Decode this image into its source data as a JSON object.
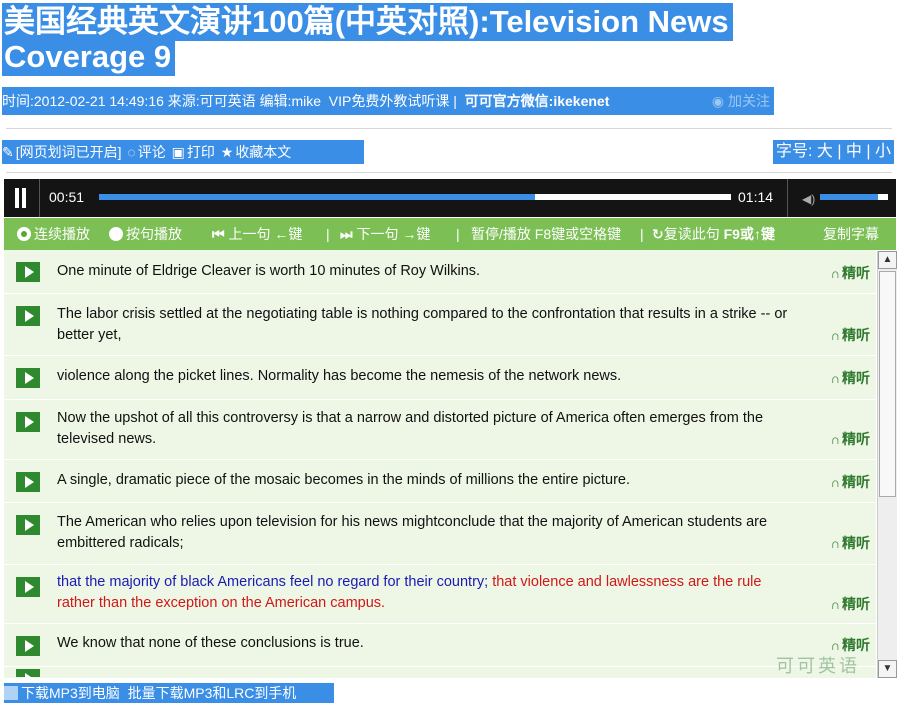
{
  "title": {
    "line1": "美国经典英文演讲100篇(中英对照):Television News",
    "line2": "Coverage 9"
  },
  "meta": {
    "time": "时间:2012-02-21 14:49:16",
    "source": "来源:可可英语",
    "editor": "编辑:mike",
    "vip": "VIP免费外教试听课 |",
    "wechat": "可可官方微信:ikekenet",
    "follow": "加关注"
  },
  "toolbar": {
    "word_lookup": "[网页划词已开启]",
    "comment": "评论",
    "print": "打印",
    "bookmark": "收藏本文"
  },
  "font_size": {
    "label": "字号:",
    "large": "大",
    "medium": "中",
    "small": "小"
  },
  "player": {
    "current": "00:51",
    "duration": "01:14",
    "progress": 0.69,
    "volume": 0.85
  },
  "controls": {
    "continuous": "连续播放",
    "by_sentence": "按句播放",
    "prev": "上一句",
    "prev_key": "←键",
    "next": "下一句",
    "next_key": "→键",
    "pause": "暂停/播放 F8键或空格键",
    "repeat": "复读此句",
    "repeat_key": "F9或↑键",
    "copy": "复制字幕"
  },
  "listen_label": "精听",
  "sentences": [
    {
      "text": "One minute of Eldrige Cleaver is worth 10 minutes of Roy Wilkins."
    },
    {
      "text": "The labor crisis settled at the negotiating table is nothing compared to the confrontation that results in a strike -- or better yet,"
    },
    {
      "text": "violence along the picket lines. Normality has become the nemesis of the network news."
    },
    {
      "text": "Now the upshot of all this controversy is that a narrow and distorted picture of America often emerges from the televised news."
    },
    {
      "text": "A single, dramatic piece of the mosaic becomes in the minds of millions the entire picture."
    },
    {
      "text": "The American who relies upon television for his news mightconclude that the majority of American students are embittered radicals;"
    },
    {
      "text_played": "that the majority of black Americans feel no regard for their country;",
      "text_current": " that violence and lawlessness are the rule rather than the exception on the American campus."
    },
    {
      "text": "We know that none of these conclusions is true."
    }
  ],
  "watermark": "可可英语",
  "download": {
    "pc": "下载MP3到电脑",
    "phone": "批量下载MP3和LRC到手机"
  },
  "colors": {
    "accent": "#3a8ee6",
    "player_bg": "#141414",
    "controls_bg": "#7bbf55",
    "row_bg": "#eef6e6",
    "played_text": "#1a1ab4",
    "current_text": "#d01818"
  }
}
